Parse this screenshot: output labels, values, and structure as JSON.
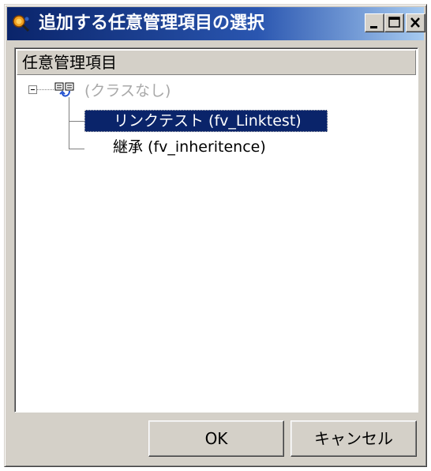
{
  "window": {
    "title": "追加する任意管理項目の選択",
    "icon": "app-magnifier-icon",
    "controls": [
      "minimize-icon",
      "maximize-icon",
      "close-icon"
    ],
    "title_gradient": [
      "#0a246a",
      "#a6caf0"
    ]
  },
  "list": {
    "column_header": "任意管理項目",
    "tree": {
      "root": {
        "label": "(クラスなし)",
        "expanded": true,
        "icon": "class-tree-icon",
        "disabled": true
      },
      "children": [
        {
          "label": "リンクテスト (fv_Linktest)",
          "selected": true
        },
        {
          "label": "継承 (fv_inheritence)",
          "selected": false
        }
      ]
    }
  },
  "buttons": {
    "ok": "OK",
    "cancel": "キャンセル"
  },
  "colors": {
    "selection": "#0a246a",
    "face": "#d4d0c8",
    "disabled_text": "#a8a8a8"
  }
}
